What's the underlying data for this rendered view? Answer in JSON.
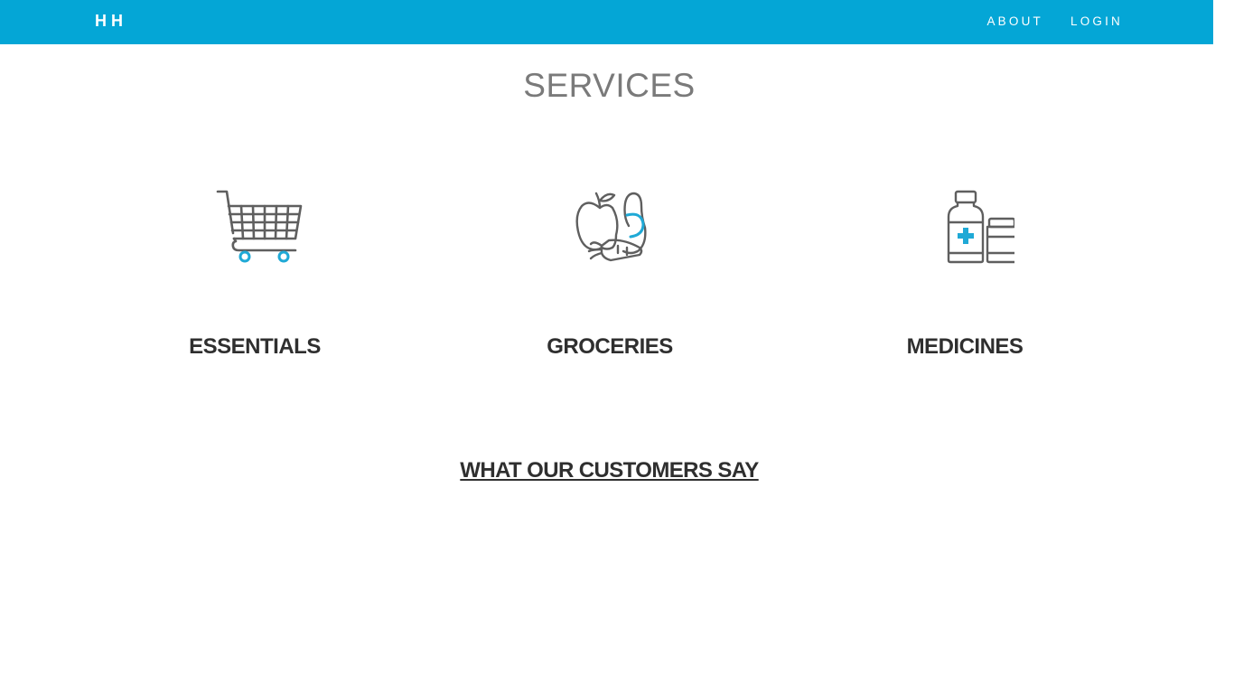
{
  "navbar": {
    "brand": "HH",
    "links": [
      {
        "label": "ABOUT"
      },
      {
        "label": "LOGIN"
      }
    ]
  },
  "services": {
    "title": "SERVICES",
    "items": [
      {
        "label": "ESSENTIALS",
        "icon": "shopping-cart-icon"
      },
      {
        "label": "GROCERIES",
        "icon": "groceries-icon"
      },
      {
        "label": "MEDICINES",
        "icon": "medicine-bottles-icon"
      }
    ]
  },
  "testimonials": {
    "title": "WHAT OUR CUSTOMERS SAY"
  },
  "colors": {
    "accent": "#04a6d6",
    "icon_stroke": "#5f5f5f",
    "icon_accent": "#1fa9d6",
    "title_gray": "#7a7a7a",
    "text_dark": "#2f2f2f"
  }
}
